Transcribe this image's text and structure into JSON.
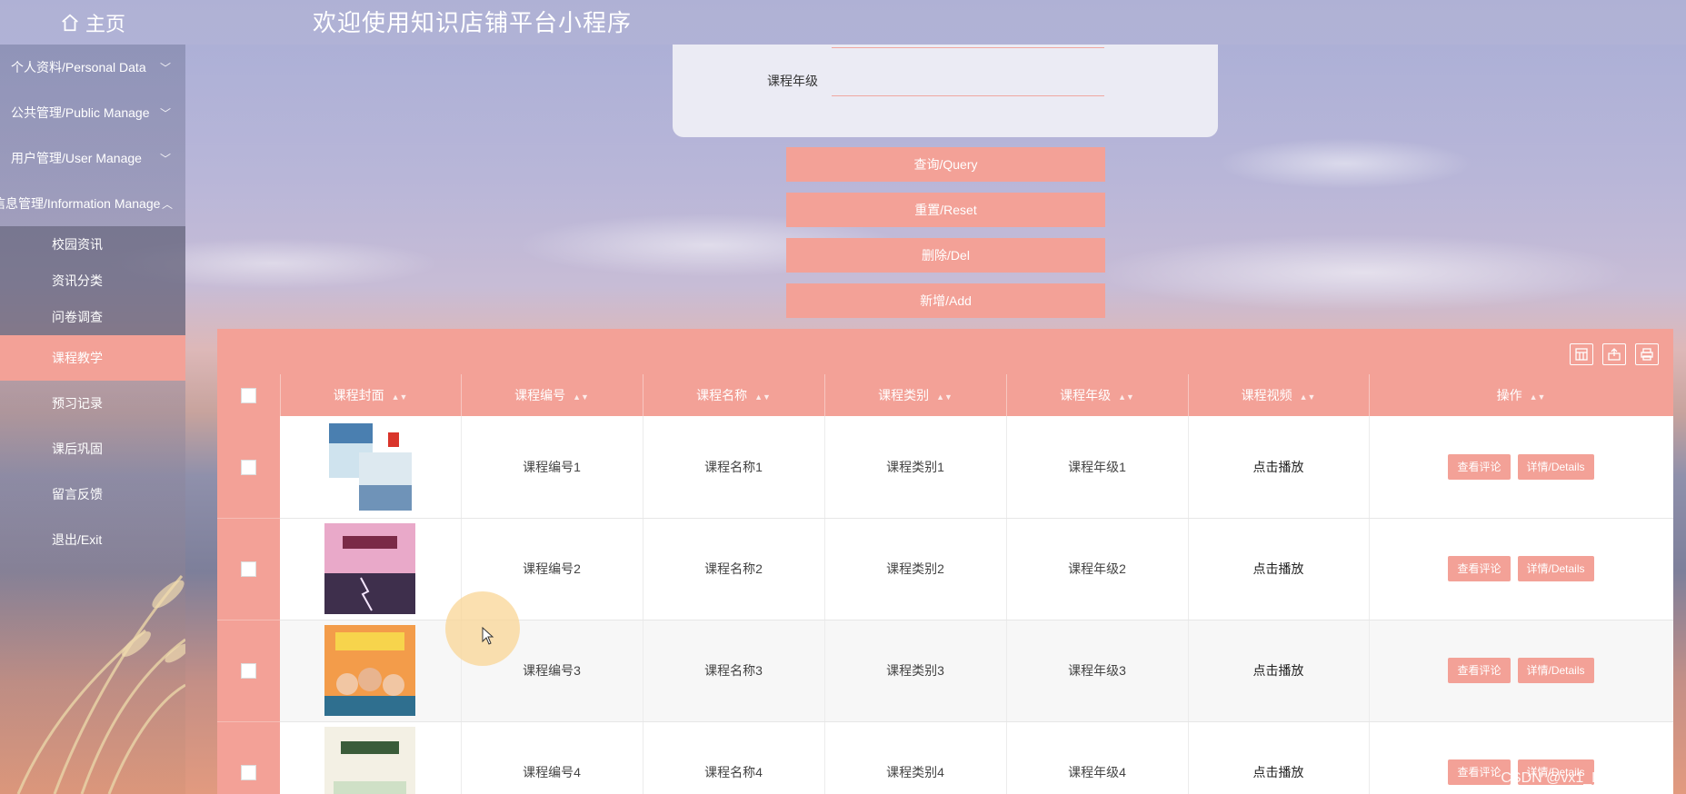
{
  "header": {
    "home_label": "主页",
    "title": "欢迎使用知识店铺平台小程序"
  },
  "sidebar": {
    "groups": [
      {
        "label": "个人资料/Personal Data"
      },
      {
        "label": "公共管理/Public Manage"
      },
      {
        "label": "用户管理/User Manage"
      },
      {
        "label": "信息管理/Information Manage"
      }
    ],
    "subitems": [
      "校园资讯",
      "资讯分类",
      "问卷调查",
      "课程教学"
    ],
    "items": [
      "预习记录",
      "课后巩固",
      "留言反馈",
      "退出/Exit"
    ]
  },
  "search": {
    "label": "课程年级",
    "value": "",
    "placeholder": ""
  },
  "buttons": {
    "query": "查询/Query",
    "reset": "重置/Reset",
    "delete": "删除/Del",
    "add": "新增/Add"
  },
  "table": {
    "headers": [
      "课程封面",
      "课程编号",
      "课程名称",
      "课程类别",
      "课程年级",
      "课程视频",
      "操作"
    ],
    "rows": [
      {
        "code": "课程编号1",
        "name": "课程名称1",
        "category": "课程类别1",
        "grade": "课程年级1",
        "video": "点击播放"
      },
      {
        "code": "课程编号2",
        "name": "课程名称2",
        "category": "课程类别2",
        "grade": "课程年级2",
        "video": "点击播放"
      },
      {
        "code": "课程编号3",
        "name": "课程名称3",
        "category": "课程类别3",
        "grade": "课程年级3",
        "video": "点击播放"
      },
      {
        "code": "课程编号4",
        "name": "课程名称4",
        "category": "课程类别4",
        "grade": "课程年级4",
        "video": "点击播放"
      }
    ],
    "op_comment": "查看评论",
    "op_details": "详情/Details"
  },
  "watermark": "CSDN @vx1_Biye_Design",
  "colors": {
    "accent": "#f3a197"
  }
}
